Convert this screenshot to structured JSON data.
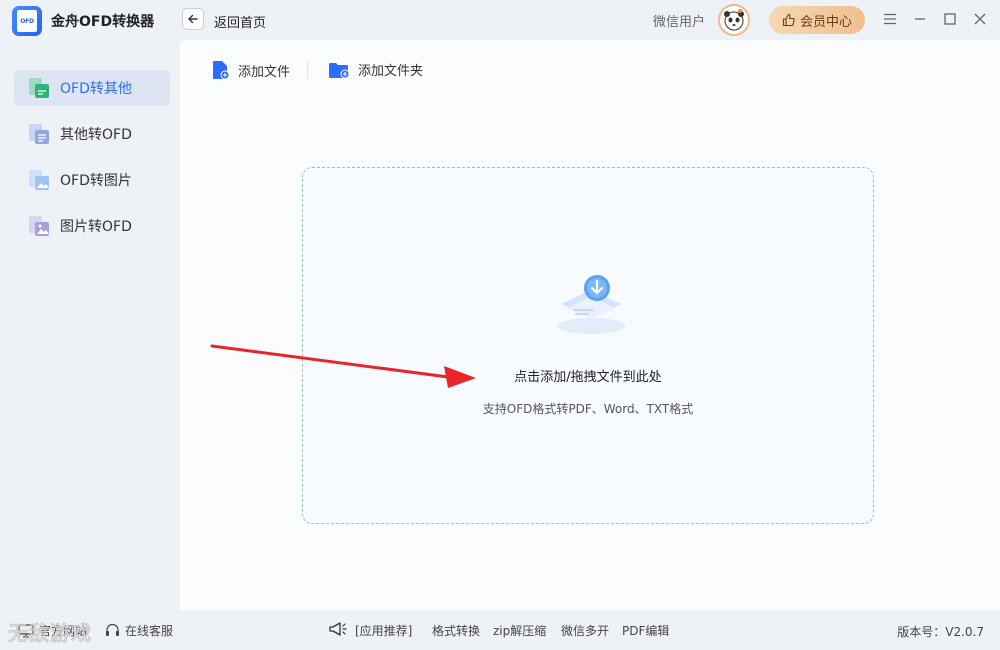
{
  "app": {
    "title": "金舟OFD转换器",
    "logo_text": "OFD",
    "back_label": "返回首页",
    "user_name": "微信用户",
    "vip_label": "会员中心"
  },
  "sidebar": {
    "items": [
      {
        "label": "OFD转其他",
        "icon": "ofd-to-other-icon",
        "active": true
      },
      {
        "label": "其他转OFD",
        "icon": "other-to-ofd-icon",
        "active": false
      },
      {
        "label": "OFD转图片",
        "icon": "ofd-to-image-icon",
        "active": false
      },
      {
        "label": "图片转OFD",
        "icon": "image-to-ofd-icon",
        "active": false
      }
    ]
  },
  "toolbar": {
    "add_file": "添加文件",
    "add_folder": "添加文件夹"
  },
  "dropzone": {
    "title": "点击添加/拖拽文件到此处",
    "subtitle": "支持OFD格式转PDF、Word、TXT格式"
  },
  "footer": {
    "website": "官方网站",
    "support": "在线客服",
    "recommend": "[应用推荐]",
    "links": [
      "格式转换",
      "zip解压缩",
      "微信多开",
      "PDF编辑"
    ],
    "version": "版本号：V2.0.7",
    "watermark": "无敌游戏"
  },
  "colors": {
    "accent": "#2f6bff",
    "active_bg": "#dde5f2",
    "arrow": "#e8262a",
    "vip_gold": "#eec08f"
  }
}
